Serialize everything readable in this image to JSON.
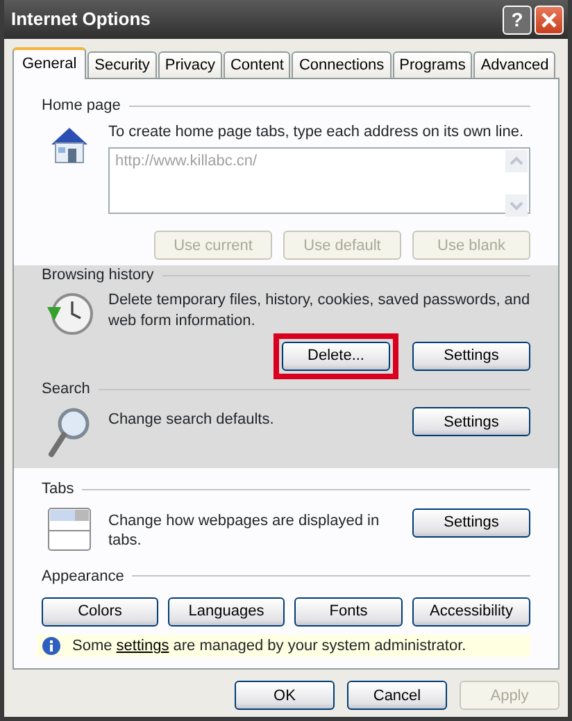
{
  "window": {
    "title": "Internet Options",
    "help_button": "?"
  },
  "tabs": [
    {
      "label": "General",
      "selected": true
    },
    {
      "label": "Security",
      "selected": false
    },
    {
      "label": "Privacy",
      "selected": false
    },
    {
      "label": "Content",
      "selected": false
    },
    {
      "label": "Connections",
      "selected": false
    },
    {
      "label": "Programs",
      "selected": false
    },
    {
      "label": "Advanced",
      "selected": false
    }
  ],
  "sections": [
    {
      "kind": "home",
      "title": "Home page",
      "highlighted": false,
      "description": "To create home page tabs, type each address on its own line.",
      "address": {
        "value": "http://www.killabc.cn/",
        "disabled": true
      },
      "buttons": [
        {
          "label": "Use current",
          "disabled": true
        },
        {
          "label": "Use default",
          "disabled": true
        },
        {
          "label": "Use blank",
          "disabled": true
        }
      ]
    },
    {
      "kind": "history",
      "title": "Browsing history",
      "highlighted": true,
      "description": "Delete temporary files, history, cookies, saved passwords, and web form information.",
      "buttons": [
        {
          "label": "Delete...",
          "disabled": false,
          "marked": true
        },
        {
          "label": "Settings",
          "disabled": false
        }
      ]
    },
    {
      "kind": "search",
      "title": "Search",
      "highlighted": true,
      "description": "Change search defaults.",
      "buttons": [
        {
          "label": "Settings",
          "disabled": false
        }
      ]
    },
    {
      "kind": "tabs",
      "title": "Tabs",
      "highlighted": false,
      "description": "Change how webpages are displayed in tabs.",
      "buttons": [
        {
          "label": "Settings",
          "disabled": false
        }
      ]
    },
    {
      "kind": "appearance",
      "title": "Appearance",
      "highlighted": false,
      "buttons": [
        {
          "label": "Colors",
          "disabled": false
        },
        {
          "label": "Languages",
          "disabled": false
        },
        {
          "label": "Fonts",
          "disabled": false
        },
        {
          "label": "Accessibility",
          "disabled": false
        }
      ]
    }
  ],
  "info": {
    "before": "Some",
    "link": "settings",
    "after": "are managed by your system administrator."
  },
  "footer_buttons": [
    {
      "label": "OK",
      "disabled": false
    },
    {
      "label": "Cancel",
      "disabled": false
    },
    {
      "label": "Apply",
      "disabled": true
    }
  ]
}
